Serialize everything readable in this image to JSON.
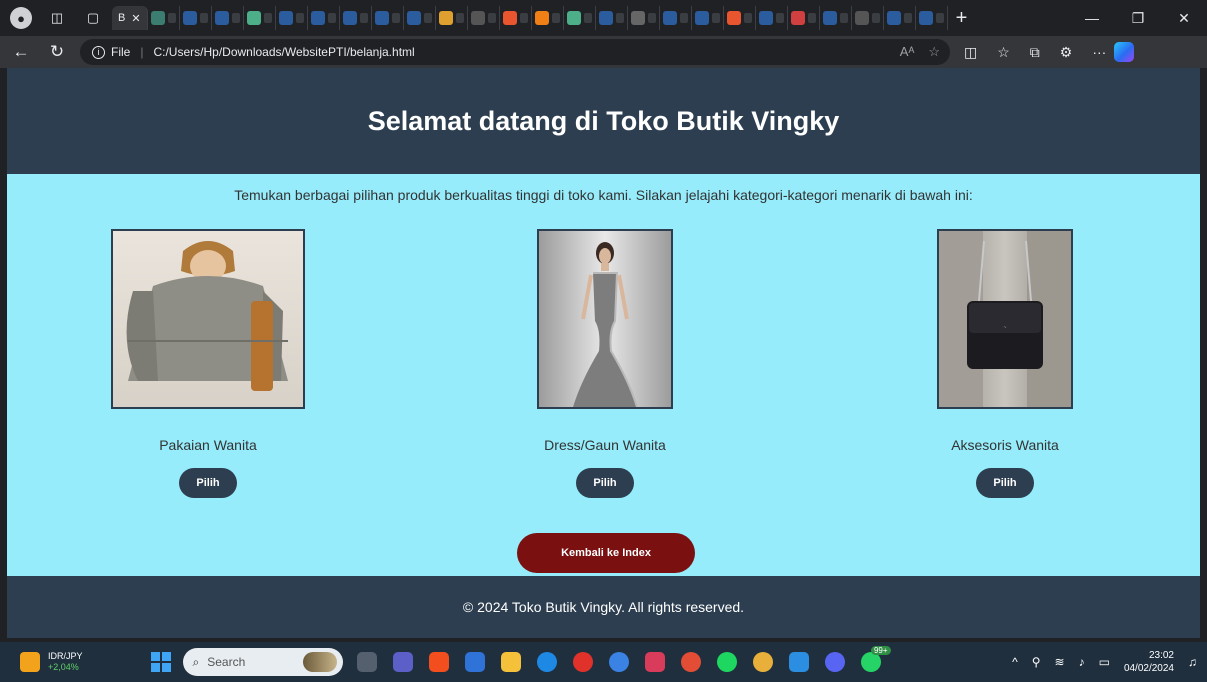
{
  "browser": {
    "active_tab_label": "B",
    "url_scheme_label": "File",
    "url": "C:/Users/Hp/Downloads/WebsitePTI/belanja.html",
    "new_tab_label": "+",
    "more_label": "···"
  },
  "page": {
    "header_title": "Selamat datang di Toko Butik Vingky",
    "intro": "Temukan berbagai pilihan produk berkualitas tinggi di toko kami. Silakan jelajahi kategori-kategori menarik di bawah ini:",
    "products": [
      {
        "name": "Pakaian Wanita",
        "button": "Pilih"
      },
      {
        "name": "Dress/Gaun Wanita",
        "button": "Pilih"
      },
      {
        "name": "Aksesoris Wanita",
        "button": "Pilih"
      }
    ],
    "back_button": "Kembali ke Index",
    "footer": "© 2024 Toko Butik Vingky. All rights reserved."
  },
  "taskbar": {
    "ticker_symbol": "IDR/JPY",
    "ticker_change": "+2,04%",
    "search_placeholder": "Search",
    "time": "23:02",
    "date": "04/02/2024",
    "badge": "99+"
  },
  "colors": {
    "header_bg": "#2c3e50",
    "page_bg": "#96ecfb",
    "back_button_bg": "#7a1010"
  }
}
